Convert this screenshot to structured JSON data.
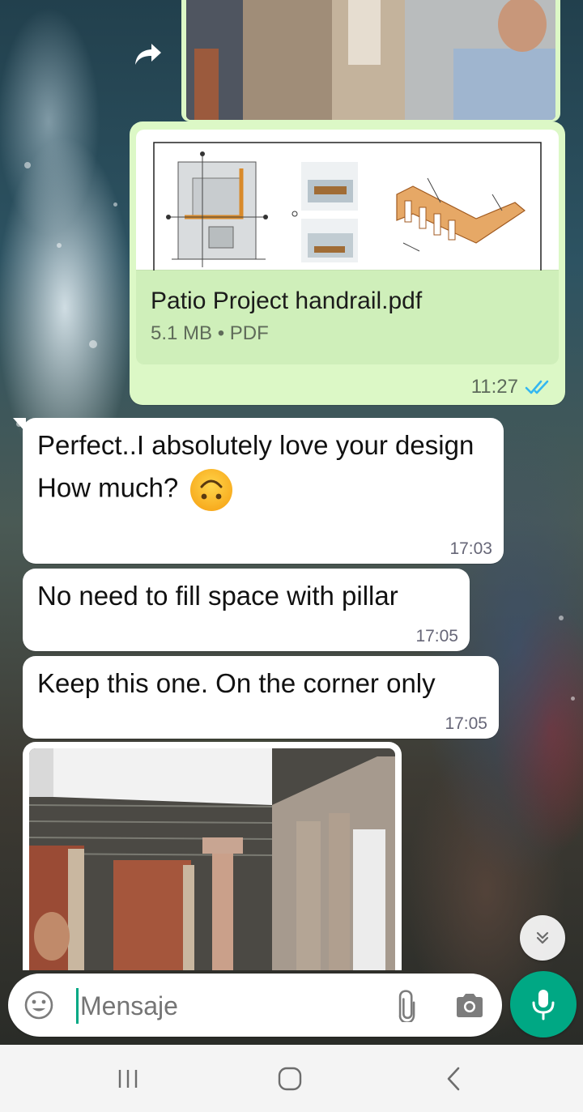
{
  "messages": [
    {
      "type": "document",
      "direction": "outgoing",
      "file_name": "Patio Project handrail.pdf",
      "file_info": "5.1 MB • PDF",
      "time": "11:27",
      "status": "read"
    },
    {
      "type": "text",
      "direction": "incoming",
      "lines": [
        "Perfect..I absolutely love your design",
        "How much?"
      ],
      "emoji": "upside-down-face",
      "time": "17:03"
    },
    {
      "type": "text",
      "direction": "incoming",
      "text": "No need to fill space with pillar",
      "time": "17:05"
    },
    {
      "type": "text",
      "direction": "incoming",
      "text": "Keep this one. On the corner only",
      "time": "17:05"
    },
    {
      "type": "image",
      "direction": "incoming"
    }
  ],
  "composer": {
    "placeholder": "Mensaje"
  },
  "colors": {
    "outgoing_bubble": "#dcf8c6",
    "incoming_bubble": "#ffffff",
    "accent": "#00a884",
    "read_ticks": "#34b7f1"
  },
  "icons": {
    "forward": "forward-arrow-icon",
    "read": "double-check-icon",
    "scroll_down": "double-chevron-down-icon",
    "emoji": "emoji-icon",
    "attach": "paperclip-icon",
    "camera": "camera-icon",
    "mic": "microphone-icon",
    "nav_recent": "recent-apps-icon",
    "nav_home": "home-icon",
    "nav_back": "back-icon"
  }
}
